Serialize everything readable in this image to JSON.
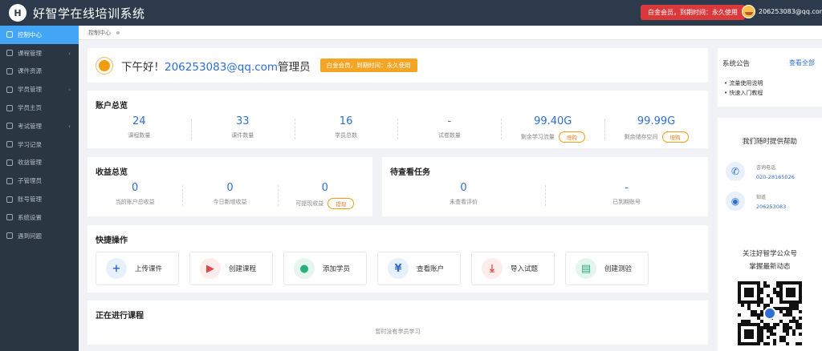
{
  "header": {
    "logo_letter": "H",
    "title": "好智学在线培训系统",
    "membership_badge": "白金会员，到期时间：永久使用",
    "user_email": "206253083@qq.com"
  },
  "sidebar": {
    "items": [
      {
        "label": "控制中心",
        "icon": "home-icon",
        "active": true,
        "has_children": false
      },
      {
        "label": "课程管理",
        "icon": "book-icon",
        "active": false,
        "has_children": true
      },
      {
        "label": "课件资源",
        "icon": "folder-icon",
        "active": false,
        "has_children": false
      },
      {
        "label": "学员管理",
        "icon": "users-icon",
        "active": false,
        "has_children": true
      },
      {
        "label": "学员主页",
        "icon": "user-home-icon",
        "active": false,
        "has_children": false
      },
      {
        "label": "考试管理",
        "icon": "exam-icon",
        "active": false,
        "has_children": true
      },
      {
        "label": "学习记录",
        "icon": "record-icon",
        "active": false,
        "has_children": false
      },
      {
        "label": "收益管理",
        "icon": "wallet-icon",
        "active": false,
        "has_children": false
      },
      {
        "label": "子管理员",
        "icon": "admin-icon",
        "active": false,
        "has_children": false
      },
      {
        "label": "账号管理",
        "icon": "dollar-icon",
        "active": false,
        "has_children": false
      },
      {
        "label": "系统设置",
        "icon": "gear-icon",
        "active": false,
        "has_children": false
      },
      {
        "label": "遇到问题",
        "icon": "help-icon",
        "active": false,
        "has_children": false
      }
    ]
  },
  "breadcrumb": {
    "current": "控制中心"
  },
  "greeting": {
    "prefix": "下午好！",
    "email": "206253083@qq.com",
    "role": "管理员",
    "badge": "白金会员，到期时间：永久使用"
  },
  "account_overview": {
    "title": "账户总览",
    "stats": [
      {
        "value": "24",
        "label": "课程数量",
        "action": ""
      },
      {
        "value": "33",
        "label": "课件数量",
        "action": ""
      },
      {
        "value": "16",
        "label": "学员总数",
        "action": ""
      },
      {
        "value": "-",
        "label": "试卷数量",
        "action": ""
      },
      {
        "value": "99.40G",
        "label": "剩余学习流量",
        "action": "增购"
      },
      {
        "value": "99.99G",
        "label": "剩余储存空间",
        "action": "增购"
      }
    ]
  },
  "income_overview": {
    "title": "收益总览",
    "stats": [
      {
        "value": "0",
        "label": "当前账户总收益",
        "action": ""
      },
      {
        "value": "0",
        "label": "今日新增收益",
        "action": ""
      },
      {
        "value": "0",
        "label": "可提现收益",
        "action": "提现"
      }
    ]
  },
  "pending_tasks": {
    "title": "待查看任务",
    "stats": [
      {
        "value": "0",
        "label": "未查看评价"
      },
      {
        "value": "-",
        "label": "已到期账号"
      }
    ]
  },
  "quick_actions": {
    "title": "快捷操作",
    "items": [
      {
        "label": "上传课件",
        "icon": "plus-icon",
        "glyph": "+",
        "color": "#2d6fd3",
        "bg": "#e8f0fb"
      },
      {
        "label": "创建课程",
        "icon": "video-icon",
        "glyph": "▶",
        "color": "#e04848",
        "bg": "#fdecec"
      },
      {
        "label": "添加学员",
        "icon": "user-add-icon",
        "glyph": "●",
        "color": "#29b07a",
        "bg": "#e4f6ee"
      },
      {
        "label": "查看账户",
        "icon": "yen-icon",
        "glyph": "¥",
        "color": "#2d6fd3",
        "bg": "#e8f0fb"
      },
      {
        "label": "导入试题",
        "icon": "download-icon",
        "glyph": "⤓",
        "color": "#e04848",
        "bg": "#fdecec"
      },
      {
        "label": "创建测验",
        "icon": "document-icon",
        "glyph": "▤",
        "color": "#29b07a",
        "bg": "#e4f6ee"
      }
    ]
  },
  "ongoing_courses": {
    "title": "正在进行课程",
    "empty_text": "暂时没有学员学习"
  },
  "notice": {
    "title": "系统公告",
    "more": "查看全部",
    "items": [
      "流量使用说明",
      "快速入门教程"
    ]
  },
  "help": {
    "title": "我们随时提供帮助",
    "phone_label": "咨询电话",
    "phone": "020-28165026",
    "qq_label": "知道",
    "qq": "206253083",
    "follow_line1": "关注好智学公众号",
    "follow_line2": "掌握最新动态"
  }
}
